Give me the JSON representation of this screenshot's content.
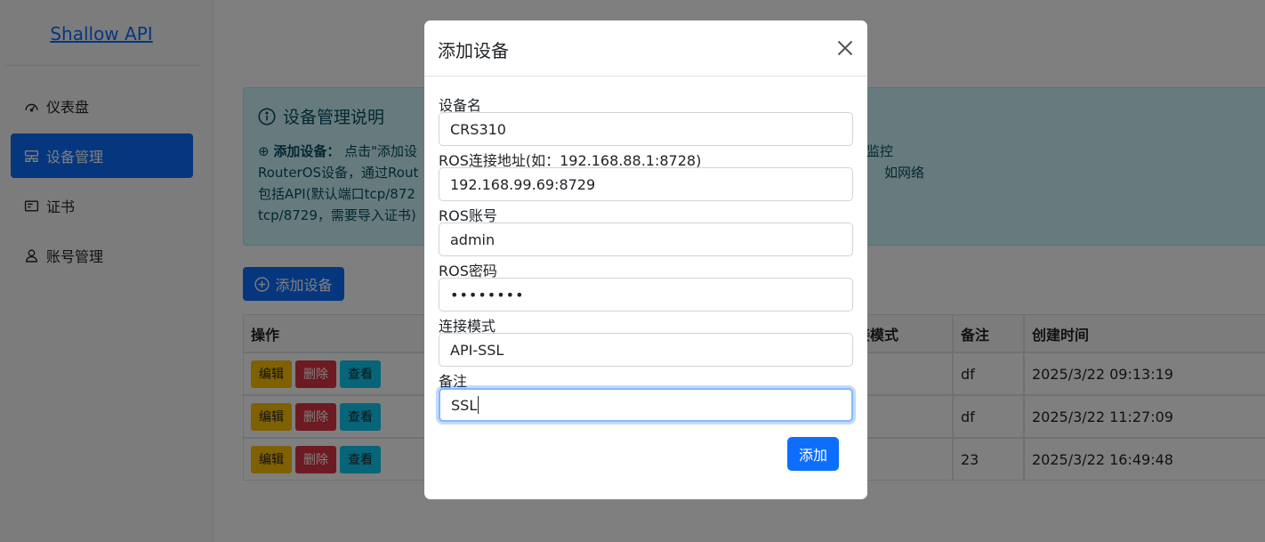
{
  "sidebar": {
    "brand": "Shallow API",
    "items": [
      {
        "label": "仪表盘",
        "icon": "dashboard-icon",
        "active": false
      },
      {
        "label": "设备管理",
        "icon": "device-icon",
        "active": true
      },
      {
        "label": "证书",
        "icon": "certificate-icon",
        "active": false
      },
      {
        "label": "账号管理",
        "icon": "user-icon",
        "active": false
      }
    ]
  },
  "info": {
    "title": "设备管理说明",
    "line1_bold": "添加设备：",
    "line1_text": "点击\"添加设",
    "line1_tail": "监控",
    "line2_text": "RouterOS设备，通过Rout",
    "line2_tail": "如网络",
    "line3_text": "包括API(默认端口tcp/872",
    "line4_text": "tcp/8729，需要导入证书)"
  },
  "main": {
    "add_button": "添加设备"
  },
  "table": {
    "headers": [
      "操作",
      "接模式",
      "备注",
      "创建时间"
    ],
    "action_labels": {
      "edit": "编辑",
      "delete": "删除",
      "view": "查看"
    },
    "rows": [
      {
        "note": "df",
        "created": "2025/3/22 09:13:19"
      },
      {
        "note": "df",
        "created": "2025/3/22 11:27:09"
      },
      {
        "note": "23",
        "created": "2025/3/22 16:49:48"
      }
    ]
  },
  "modal": {
    "title": "添加设备",
    "fields": [
      {
        "label": "设备名",
        "value": "CRS310"
      },
      {
        "label": "ROS连接地址(如：192.168.88.1:8728)",
        "value": "192.168.99.69:8729"
      },
      {
        "label": "ROS账号",
        "value": "admin"
      },
      {
        "label": "ROS密码",
        "value": "••••••••"
      },
      {
        "label": "连接模式",
        "value": "API-SSL"
      },
      {
        "label": "备注",
        "value": "SSL"
      }
    ],
    "submit": "添加"
  },
  "colors": {
    "primary": "#0d6efd",
    "warning": "#ffc107",
    "danger": "#dc3545",
    "info": "#0dcaf0",
    "info_bg": "#cff4fc"
  }
}
